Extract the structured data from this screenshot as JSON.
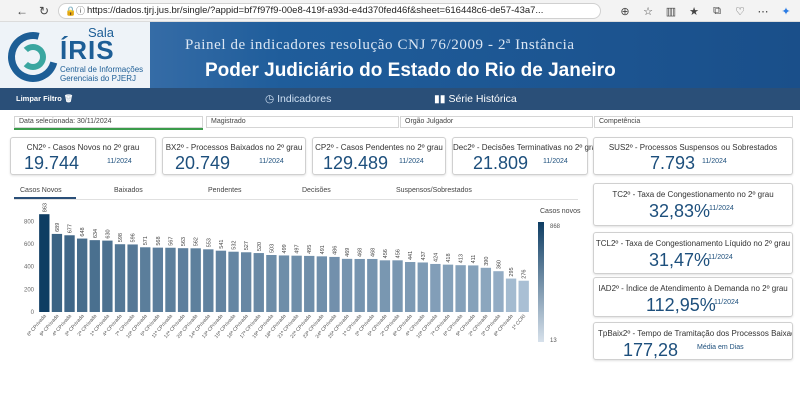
{
  "browser": {
    "url": "https://dados.tjrj.jus.br/single/?appid=bf7f97f9-00e8-419f-a93d-e4d370fed46f&sheet=616448c6-de57-43a7..."
  },
  "logo": {
    "sala": "Sala",
    "iris": "ÍRIS",
    "subtitle": "Central de Informações Gerenciais do PJERJ"
  },
  "banner": {
    "title": "Painel de indicadores resolução CNJ  76/2009  -  2ª Instância",
    "subtitle": "Poder Judiciário do Estado do Rio de Janeiro"
  },
  "nav": {
    "clear_filter": "Limpar Filtro",
    "indicators": "Indicadores",
    "history": "Série Histórica"
  },
  "filters": {
    "date": "Data selecionada: 30/11/2024",
    "magistrate": "Magistrado",
    "organ": "Orgão Julgador",
    "competence": "Competência"
  },
  "cards": [
    {
      "label": "CN2º - Casos Novos no 2º grau",
      "value": "19.744",
      "period": "11/2024"
    },
    {
      "label": "BX2º - Processos Baixados no 2º grau",
      "value": "20.749",
      "period": "11/2024"
    },
    {
      "label": "CP2º - Casos Pendentes no 2º grau",
      "value": "129.489",
      "period": "11/2024"
    },
    {
      "label": "Dec2º - Decisões Terminativas no 2º grau",
      "value": "21.809",
      "period": "11/2024"
    },
    {
      "label": "SUS2º - Processos Suspensos ou Sobrestados",
      "value": "7.793",
      "period": "11/2024"
    }
  ],
  "rates": [
    {
      "label": "TC2º - Taxa de Congestionamento no 2º grau",
      "value": "32,83%",
      "period": "11/2024"
    },
    {
      "label": "TCL2º - Taxa de Congestionamento Líquido no 2º grau",
      "value": "31,47%",
      "period": "11/2024"
    },
    {
      "label": "IAD2º - Índice de Atendimento à Demanda no 2º grau",
      "value": "112,95%",
      "period": "11/2024"
    },
    {
      "label": "TpBaix2º - Tempo de Tramitação dos Processos Baixados no 2...",
      "value": "177,28",
      "period": "Média em Dias"
    }
  ],
  "tabs": [
    "Casos Novos",
    "Baixados",
    "Pendentes",
    "Decisões",
    "Suspensos/Sobrestados"
  ],
  "colors": {
    "bar_dark": "#0e3d63",
    "bar_light": "#a9bfd4",
    "accent": "#2a4f78"
  },
  "chart_data": {
    "type": "bar",
    "categories": [
      "6ª CPrivada",
      "9ª CPrivada",
      "4ª CPrivada",
      "3ª CPrivada",
      "2ª CPrivada",
      "1ª CPrivada",
      "4ª CPrivada",
      "7ª CPrivada",
      "10ª CPrivada",
      "5ª CPrivada",
      "11ª CPrivada",
      "12ª CPrivada",
      "20ª CPrivada",
      "14ª CPrivada",
      "13ª CPrivada",
      "15ª CPrivada",
      "16ª CPrivada",
      "17ª CPrivada",
      "19ª CPrivada",
      "18ª CPrivada",
      "21ª CPrivada",
      "22ª CPrivada",
      "23ª CPrivada",
      "24ª CPrivada",
      "25ª CPrivada",
      "1ª CPrivada",
      "3ª CPrivada",
      "5ª CPrivada",
      "2ª CPrivada",
      "8ª CPrivada",
      "4ª CPrivada",
      "10ª CPrivada",
      "7ª CPrivada",
      "6ª CPrivada",
      "9ª CPrivada",
      "2ª CPrivada",
      "3ª CPrivada",
      "8ª CPrivada",
      "1ª CCRI"
    ],
    "values": [
      863,
      689,
      677,
      648,
      634,
      630,
      598,
      596,
      571,
      568,
      567,
      563,
      562,
      553,
      541,
      532,
      527,
      520,
      503,
      499,
      497,
      495,
      491,
      486,
      469,
      468,
      468,
      456,
      456,
      441,
      437,
      424,
      418,
      413,
      411,
      390,
      360,
      295,
      276
    ],
    "ylim": [
      0,
      900
    ],
    "yticks": [
      0,
      200,
      400,
      600,
      800
    ],
    "legend_title": "Casos novos",
    "legend_max": "868",
    "legend_min": "13"
  }
}
